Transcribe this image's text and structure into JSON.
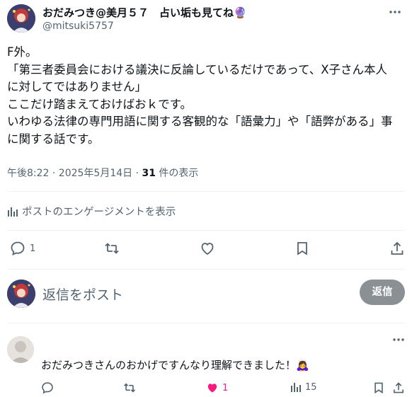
{
  "post": {
    "author_name": "おだみつき@美月５７　占い垢も見てね",
    "author_emoji": "🔮",
    "handle": "@mitsuki5757",
    "more_icon": "more-horizontal-icon",
    "lines": [
      "F外。",
      "「第三者委員会における議決に反論しているだけであって、X子さん本人",
      "に対してではありません」",
      "ここだけ踏まえておけばおｋです。",
      "いわゆる法律の専門用語に関する客観的な「語彙力」や「語弊がある」事",
      "に関する話です。"
    ],
    "timestamp": "午後8:22 · 2025年5月14日 · ",
    "views_count": "31",
    "views_label": " 件の表示"
  },
  "engagement_link": "ポストのエンゲージメントを表示",
  "actions": {
    "reply_count": "1",
    "retweet_count": "",
    "like_count": "",
    "bookmark_count": "",
    "share_count": ""
  },
  "reply_box": {
    "placeholder": "返信をポスト",
    "button_label": "返信"
  },
  "comment": {
    "header_text": "　　　　　　　　　　　　　　",
    "handle": "",
    "text": "おだみつきさんのおかげですんなり理解できました！",
    "emoji": "🙇‍♀️",
    "reply_count": "",
    "retweet_count": "",
    "like_count": "1",
    "views_count": "15"
  },
  "colors": {
    "text_primary": "#0f1419",
    "text_secondary": "#536471",
    "divider": "#eff3f4",
    "reply_button_disabled": "#8b9095",
    "like_active": "#f91880"
  }
}
